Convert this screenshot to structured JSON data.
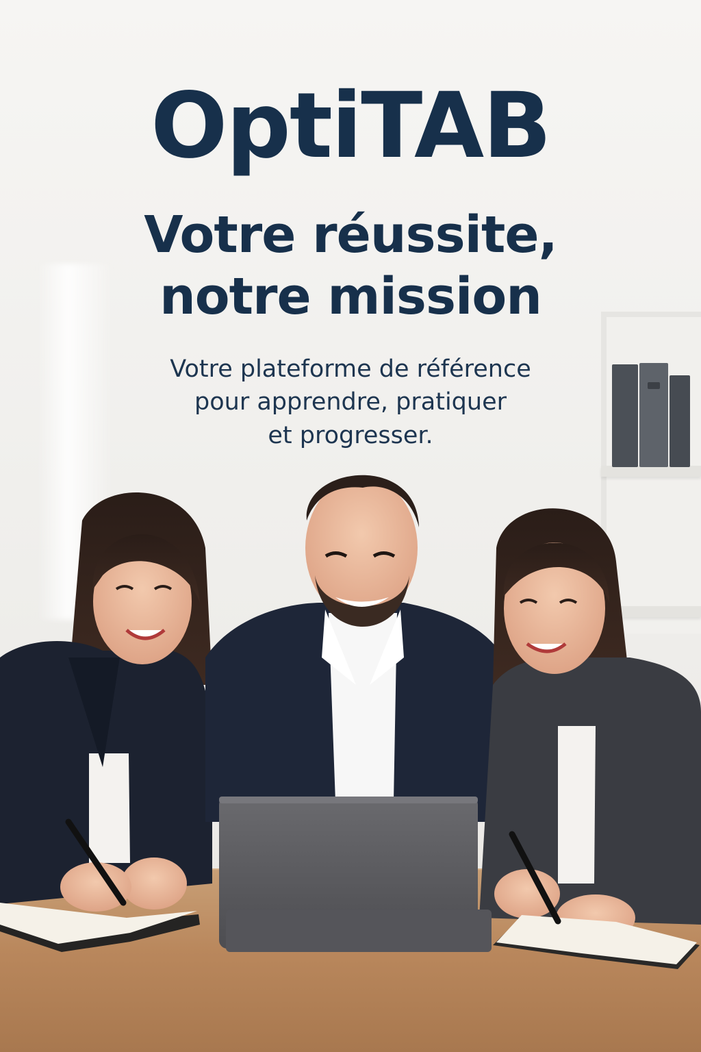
{
  "hero": {
    "brand": "OptiTAB",
    "tagline_line1": "Votre réussite,",
    "tagline_line2": "notre mission",
    "subtitle_lines": [
      "Votre plateforme de référence",
      "pour apprendre, pratiquer",
      "et progresser."
    ]
  },
  "colors": {
    "text_primary": "#17304b",
    "wall": "#f3f2ef",
    "desk": "#b9875c",
    "suit_dark": "#1c2331",
    "suit_grey": "#3b3d42",
    "laptop": "#5a5a5e"
  },
  "scene": {
    "people": [
      "woman-left",
      "man-center",
      "woman-right"
    ],
    "objects": [
      "laptop",
      "notebook-left",
      "notebook-right",
      "pen-left",
      "pen-right",
      "bookshelf",
      "binders"
    ]
  }
}
